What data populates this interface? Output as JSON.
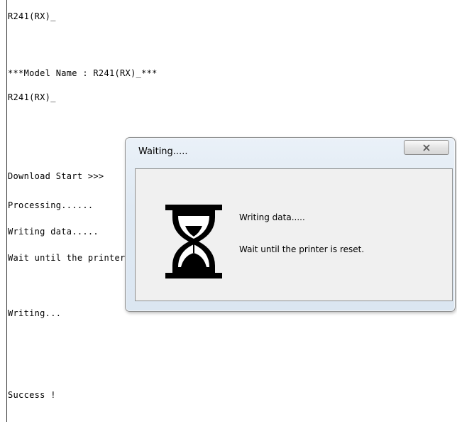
{
  "console": {
    "lines": [
      "R241(RX)_",
      "***Model Name : R241(RX)_***",
      "R241(RX)_",
      "Download Start >>>",
      "Processing......",
      "Writing data.....",
      "Wait until the printer is reset.",
      "Writing...",
      "Success !"
    ]
  },
  "dialog": {
    "title": "Waiting.....",
    "close_icon": "close-icon",
    "hourglass_icon": "hourglass-icon",
    "message_line1": "Writing data.....",
    "message_line2": "Wait until the printer is reset."
  }
}
